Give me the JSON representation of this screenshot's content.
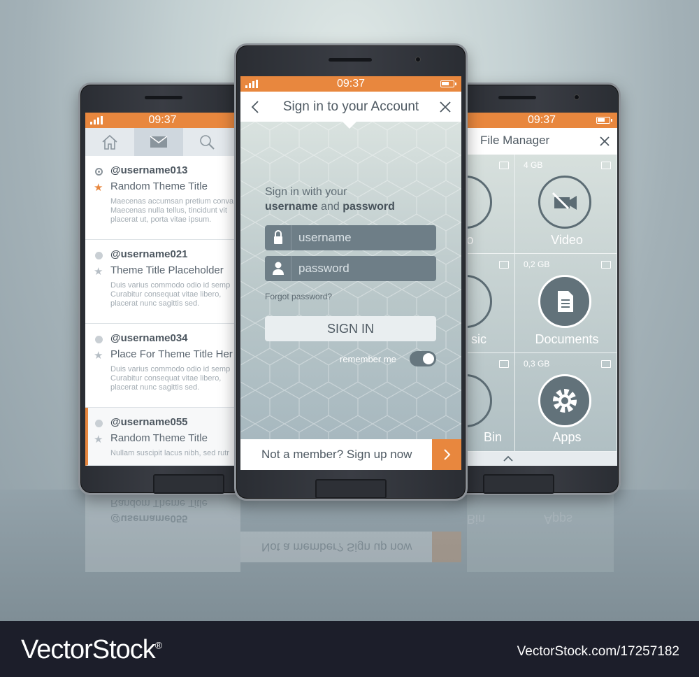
{
  "status": {
    "time": "09:37"
  },
  "left_phone": {
    "tabs": [
      {
        "icon": "home-icon"
      },
      {
        "icon": "mail-icon"
      },
      {
        "icon": "search-icon"
      }
    ],
    "messages": [
      {
        "user": "@username013",
        "subject": "Random Theme Title",
        "starred": true,
        "body": [
          "Maecenas accumsan pretium conva",
          "Maecenas nulla tellus, tincidunt vit",
          "placerat ut, porta vitae ipsum."
        ]
      },
      {
        "user": "@username021",
        "subject": "Theme Title Placeholder",
        "starred": false,
        "body": [
          "Duis varius commodo odio id semp",
          "Curabitur consequat vitae libero,",
          "placerat nunc sagittis sed."
        ]
      },
      {
        "user": "@username034",
        "subject": "Place For Theme Title Her",
        "starred": false,
        "body": [
          "Duis varius commodo odio id semp",
          "Curabitur consequat vitae libero,",
          "placerat nunc sagittis sed."
        ]
      },
      {
        "user": "@username055",
        "subject": "Random Theme Title",
        "starred": false,
        "body": [
          "Nullam suscipit lacus nibh, sed rutr"
        ]
      }
    ]
  },
  "center_phone": {
    "title": "Sign in to your Account",
    "intro_line1": "Sign in with your",
    "intro_user": "username",
    "intro_and": "and",
    "intro_pass": "password",
    "username_placeholder": "username",
    "password_placeholder": "password",
    "forgot": "Forgot password?",
    "sign_in": "SIGN IN",
    "remember": "remember me",
    "remember_on": true,
    "signup": "Not a member? Sign up now"
  },
  "right_phone": {
    "title": "File Manager",
    "cells": [
      {
        "size": "",
        "name": "oto",
        "icon": "camera-icon"
      },
      {
        "size": "4 GB",
        "name": "Video",
        "icon": "video-camera-icon"
      },
      {
        "size": "",
        "name": "sic",
        "icon": "music-icon"
      },
      {
        "size": "0,2 GB",
        "name": "Documents",
        "icon": "document-icon"
      },
      {
        "size": "",
        "name": "Bin",
        "icon": "trash-icon"
      },
      {
        "size": "0,3 GB",
        "name": "Apps",
        "icon": "gear-icon"
      }
    ]
  },
  "watermark": {
    "brand": "VectorStock",
    "reg": "®",
    "url": "VectorStock.com/17257182"
  },
  "colors": {
    "accent": "#e8873e",
    "field": "#6e7e87",
    "bg": "#1c1e2a"
  }
}
